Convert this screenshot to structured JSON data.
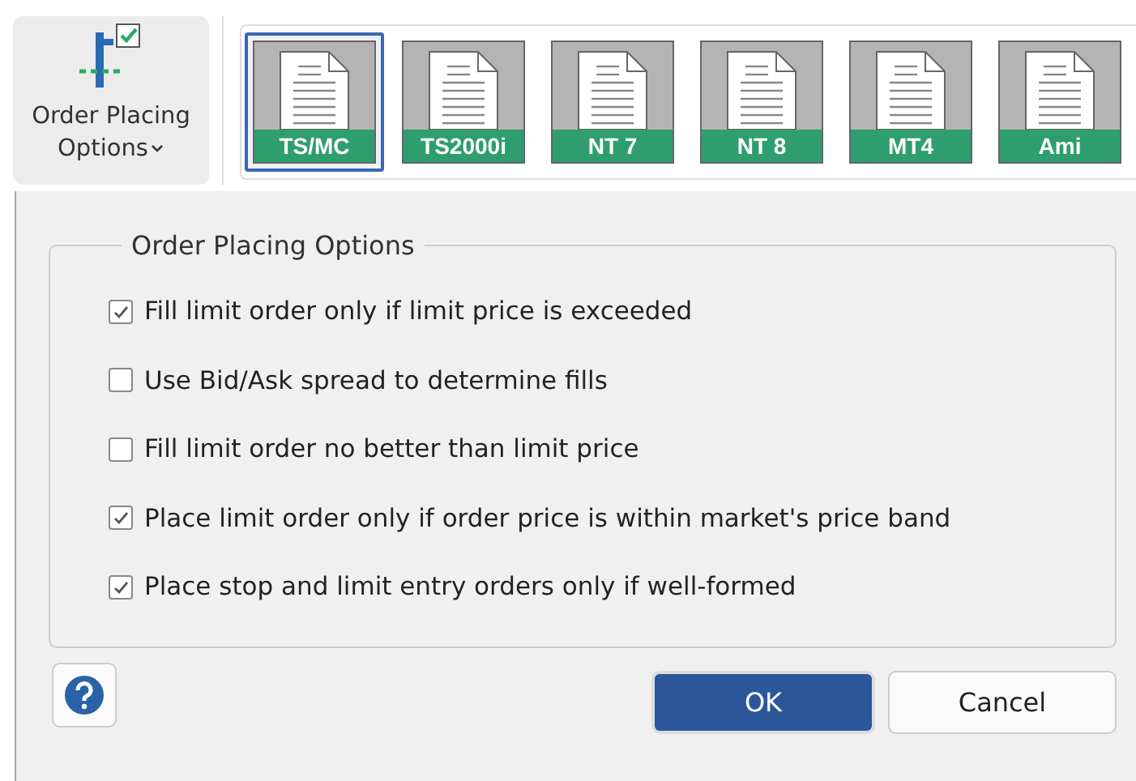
{
  "ribbon": {
    "button": {
      "label_line_1": "Order Placing",
      "label_line_2": "Options",
      "checked": true
    },
    "gallery": [
      {
        "label": "TS/MC",
        "selected": true
      },
      {
        "label": "TS2000i",
        "selected": false
      },
      {
        "label": "NT 7",
        "selected": false
      },
      {
        "label": "NT 8",
        "selected": false
      },
      {
        "label": "MT4",
        "selected": false
      },
      {
        "label": "Ami",
        "selected": false
      }
    ]
  },
  "group": {
    "title": "Order Placing Options",
    "options": [
      {
        "label": "Fill limit order only if limit price is exceeded",
        "checked": true
      },
      {
        "label": "Use Bid/Ask spread to determine fills",
        "checked": false
      },
      {
        "label": "Fill limit order no better than limit price",
        "checked": false
      },
      {
        "label": "Place limit order only if order price is within market's price band",
        "checked": true
      },
      {
        "label": "Place stop and limit entry orders only if well-formed",
        "checked": true
      }
    ]
  },
  "buttons": [
    {
      "label": "OK",
      "kind": "primary"
    },
    {
      "label": "Cancel",
      "kind": "secondary"
    }
  ]
}
